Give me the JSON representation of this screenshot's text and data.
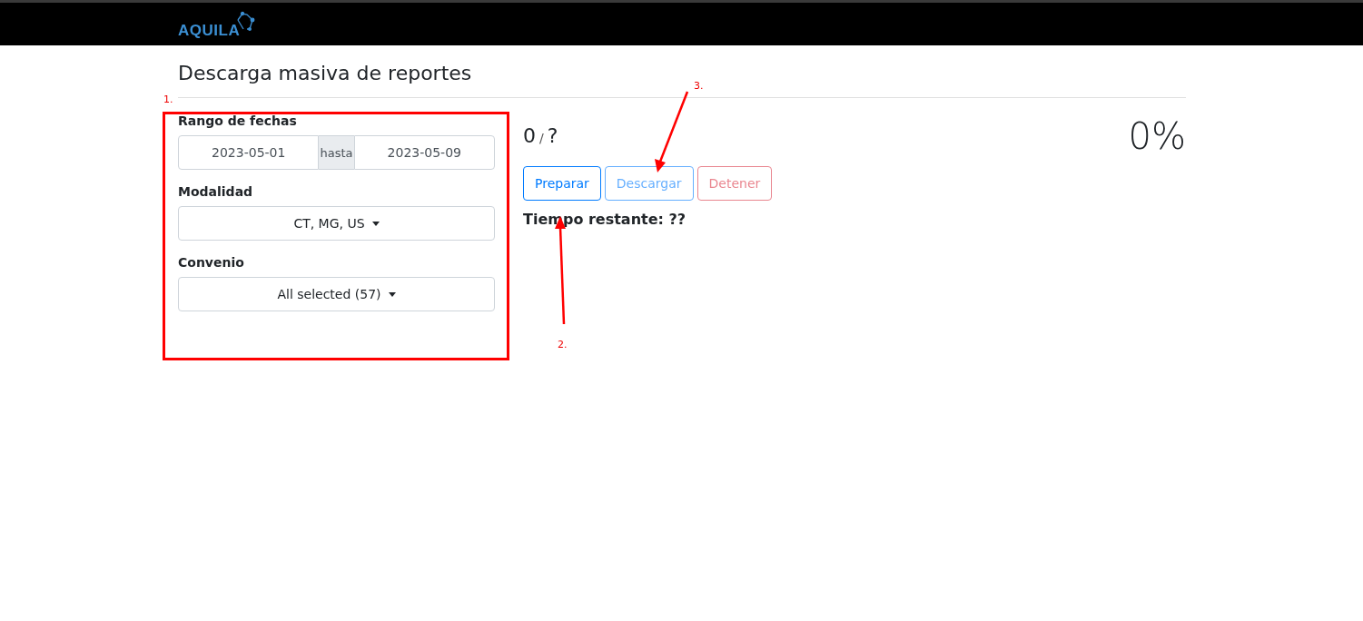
{
  "navbar": {
    "logo": "AQUILA"
  },
  "page_title": "Descarga masiva de reportes",
  "filters": {
    "date_range": {
      "label": "Rango de fechas",
      "from": "2023-05-01",
      "separator": "hasta",
      "to": "2023-05-09"
    },
    "modalidad": {
      "label": "Modalidad",
      "value": "CT, MG, US"
    },
    "convenio": {
      "label": "Convenio",
      "value": "All selected (57)"
    }
  },
  "progress": {
    "done": "0",
    "separator": "/",
    "total": "?",
    "percent": "0%"
  },
  "buttons": [
    {
      "label": "Preparar",
      "kind": "primary",
      "disabled": false
    },
    {
      "label": "Descargar",
      "kind": "info",
      "disabled": true
    },
    {
      "label": "Detener",
      "kind": "danger",
      "disabled": true
    }
  ],
  "remaining": "Tiempo restante: ??",
  "annotations": [
    "1.",
    "2.",
    "3."
  ]
}
